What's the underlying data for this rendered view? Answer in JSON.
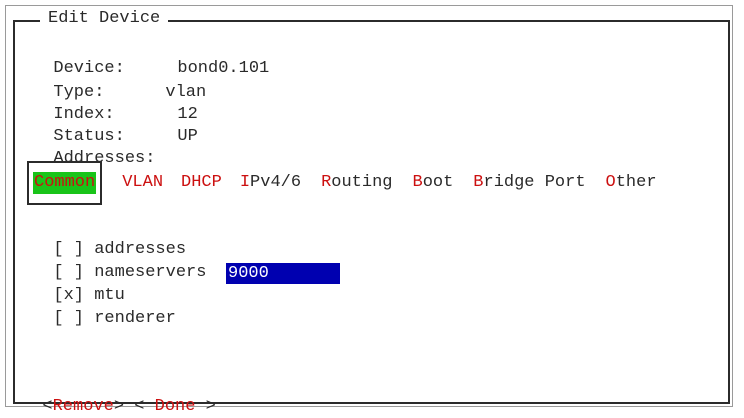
{
  "dialog": {
    "title": "Edit Device"
  },
  "device_info": {
    "device_label": "Device:",
    "device_value": "bond0.101",
    "type_label": "Type:",
    "type_value": "vlan",
    "index_label": "Index:",
    "index_value": "12",
    "status_label": "Status:",
    "status_value": "UP",
    "addresses_label": "Addresses:"
  },
  "tabs": [
    {
      "hot": "C",
      "rest": "ommon",
      "selected": true
    },
    {
      "hot": "",
      "rest": "VLAN",
      "selected": false
    },
    {
      "hot": "",
      "rest": "DHCP",
      "selected": false
    },
    {
      "hot": "I",
      "rest": "Pv4/6",
      "selected": false
    },
    {
      "hot": "R",
      "rest": "outing",
      "selected": false
    },
    {
      "hot": "B",
      "rest": "oot",
      "selected": false
    },
    {
      "hot": "B",
      "rest": "ridge Port",
      "selected": false
    },
    {
      "hot": "O",
      "rest": "ther",
      "selected": false
    }
  ],
  "options": [
    {
      "box": "[ ]",
      "label": "addresses"
    },
    {
      "box": "[ ]",
      "label": "nameservers"
    },
    {
      "box": "[x]",
      "label": "mtu"
    },
    {
      "box": "[ ]",
      "label": "renderer"
    }
  ],
  "mtu_value": "9000",
  "buttons": {
    "remove_open": "<",
    "remove_hot": "Remove",
    "remove_close": ">",
    "done_open": "< ",
    "done_hot": "Done",
    "done_close": " >"
  },
  "colors": {
    "selected_tab_bg": "#19c419",
    "hotkey": "#cc1010",
    "mtu_field_bg": "#0000b0",
    "text": "#2a2a2a"
  }
}
